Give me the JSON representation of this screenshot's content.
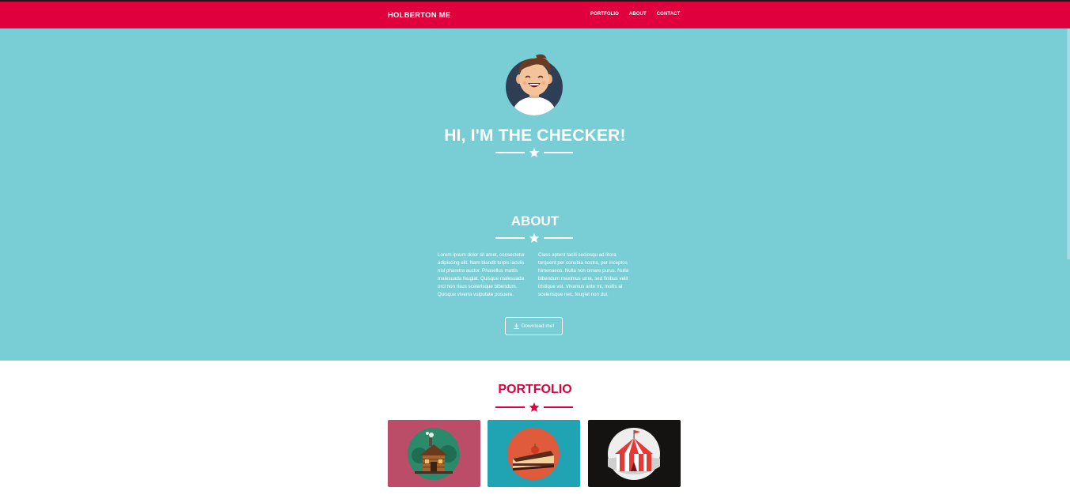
{
  "navbar": {
    "brand": "HOLBERTON ME",
    "links": [
      "PORTFOLIO",
      "ABOUT",
      "CONTACT"
    ],
    "background": "#e0003d"
  },
  "hero": {
    "title": "HI, I'M THE CHECKER!",
    "background": "#79cdd4",
    "avatar_icon": "avatar-icon",
    "divider_icon": "star-icon"
  },
  "about": {
    "title": "ABOUT",
    "column_1": "Lorem ipsum dolor sit amet, consectetur adipiscing elit. Nam blandit turpis iaculis nisl pharetra auctor. Phasellus mattis malesuada feugiat. Quisque malesuada orci non risus scelerisque bibendum. Quisque viverra vulputate posuere.",
    "column_2": "Class aptent taciti sociosqu ad litora torquent per conubia nostra, per inceptos himenaeos. Nulla non ornare purus. Nulla bibendum maximus urna, sed finibus velit tristique vel. Vivamus ante mi, mollis at scelerisque nec, feugiat non dui.",
    "download_label": "Download me!",
    "download_icon": "download-icon"
  },
  "portfolio": {
    "title": "PORTFOLIO",
    "accent": "#e0003d",
    "items": [
      {
        "icon": "cabin-icon",
        "background": "#bb4d68"
      },
      {
        "icon": "cake-icon",
        "background": "#20a3b3"
      },
      {
        "icon": "circus-tent-icon",
        "background": "#151212"
      }
    ]
  }
}
